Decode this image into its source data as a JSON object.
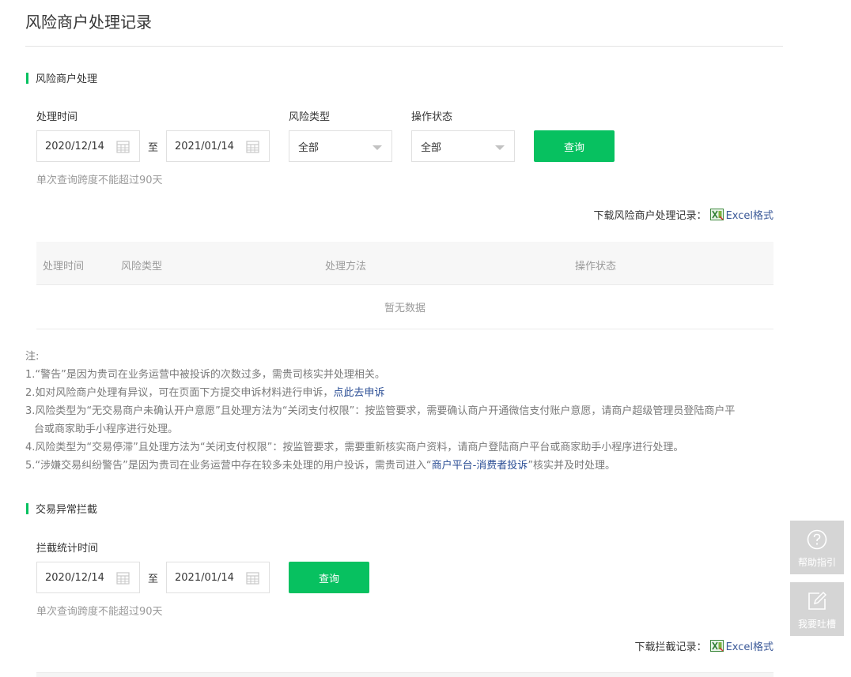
{
  "page": {
    "title": "风险商户处理记录"
  },
  "risk_section": {
    "heading": "风险商户处理",
    "time_label": "处理时间",
    "start_date": "2020/12/14",
    "to": "至",
    "end_date": "2021/01/14",
    "type_label": "风险类型",
    "type_value": "全部",
    "status_label": "操作状态",
    "status_value": "全部",
    "query_label": "查询",
    "hint": "单次查询跨度不能超过90天",
    "download_label": "下载风险商户处理记录：",
    "download_link": "Excel格式",
    "table": {
      "columns": [
        "处理时间",
        "风险类型",
        "处理方法",
        "操作状态"
      ],
      "empty_text": "暂无数据"
    }
  },
  "notes": {
    "title": "注:",
    "line1": "1.“警告”是因为贵司在业务运营中被投诉的次数过多，需贵司核实并处理相关。",
    "line2_prefix": "2.如对风险商户处理有异议，可在页面下方提交申诉材料进行申诉，",
    "line2_link": "点此去申诉",
    "line3a": "3.风险类型为“无交易商户未确认开户意愿”且处理方法为“关闭支付权限”：按监管要求，需要确认商户开通微信支付账户意愿，请商户超级管理员登陆商户平",
    "line3b": "台或商家助手小程序进行处理。",
    "line4": "4.风险类型为“交易停滞”且处理方法为“关闭支付权限”：按监管要求，需要重新核实商户资料，请商户登陆商户平台或商家助手小程序进行处理。",
    "line5_prefix": "5.“涉嫌交易纠纷警告”是因为贵司在业务运营中存在较多未处理的用户投诉，需贵司进入“",
    "line5_link": "商户平台-消费者投诉",
    "line5_suffix": "”核实并及时处理。"
  },
  "intercept_section": {
    "heading": "交易异常拦截",
    "time_label": "拦截统计时间",
    "start_date": "2020/12/14",
    "to": "至",
    "end_date": "2021/01/14",
    "query_label": "查询",
    "hint": "单次查询跨度不能超过90天",
    "download_label": "下载拦截记录：",
    "download_link": "Excel格式"
  },
  "side": {
    "help_label": "帮助指引",
    "feedback_label": "我要吐槽"
  },
  "colors": {
    "accent": "#07c160",
    "link": "#3b5998",
    "side_bg": "#d5d5d5"
  }
}
